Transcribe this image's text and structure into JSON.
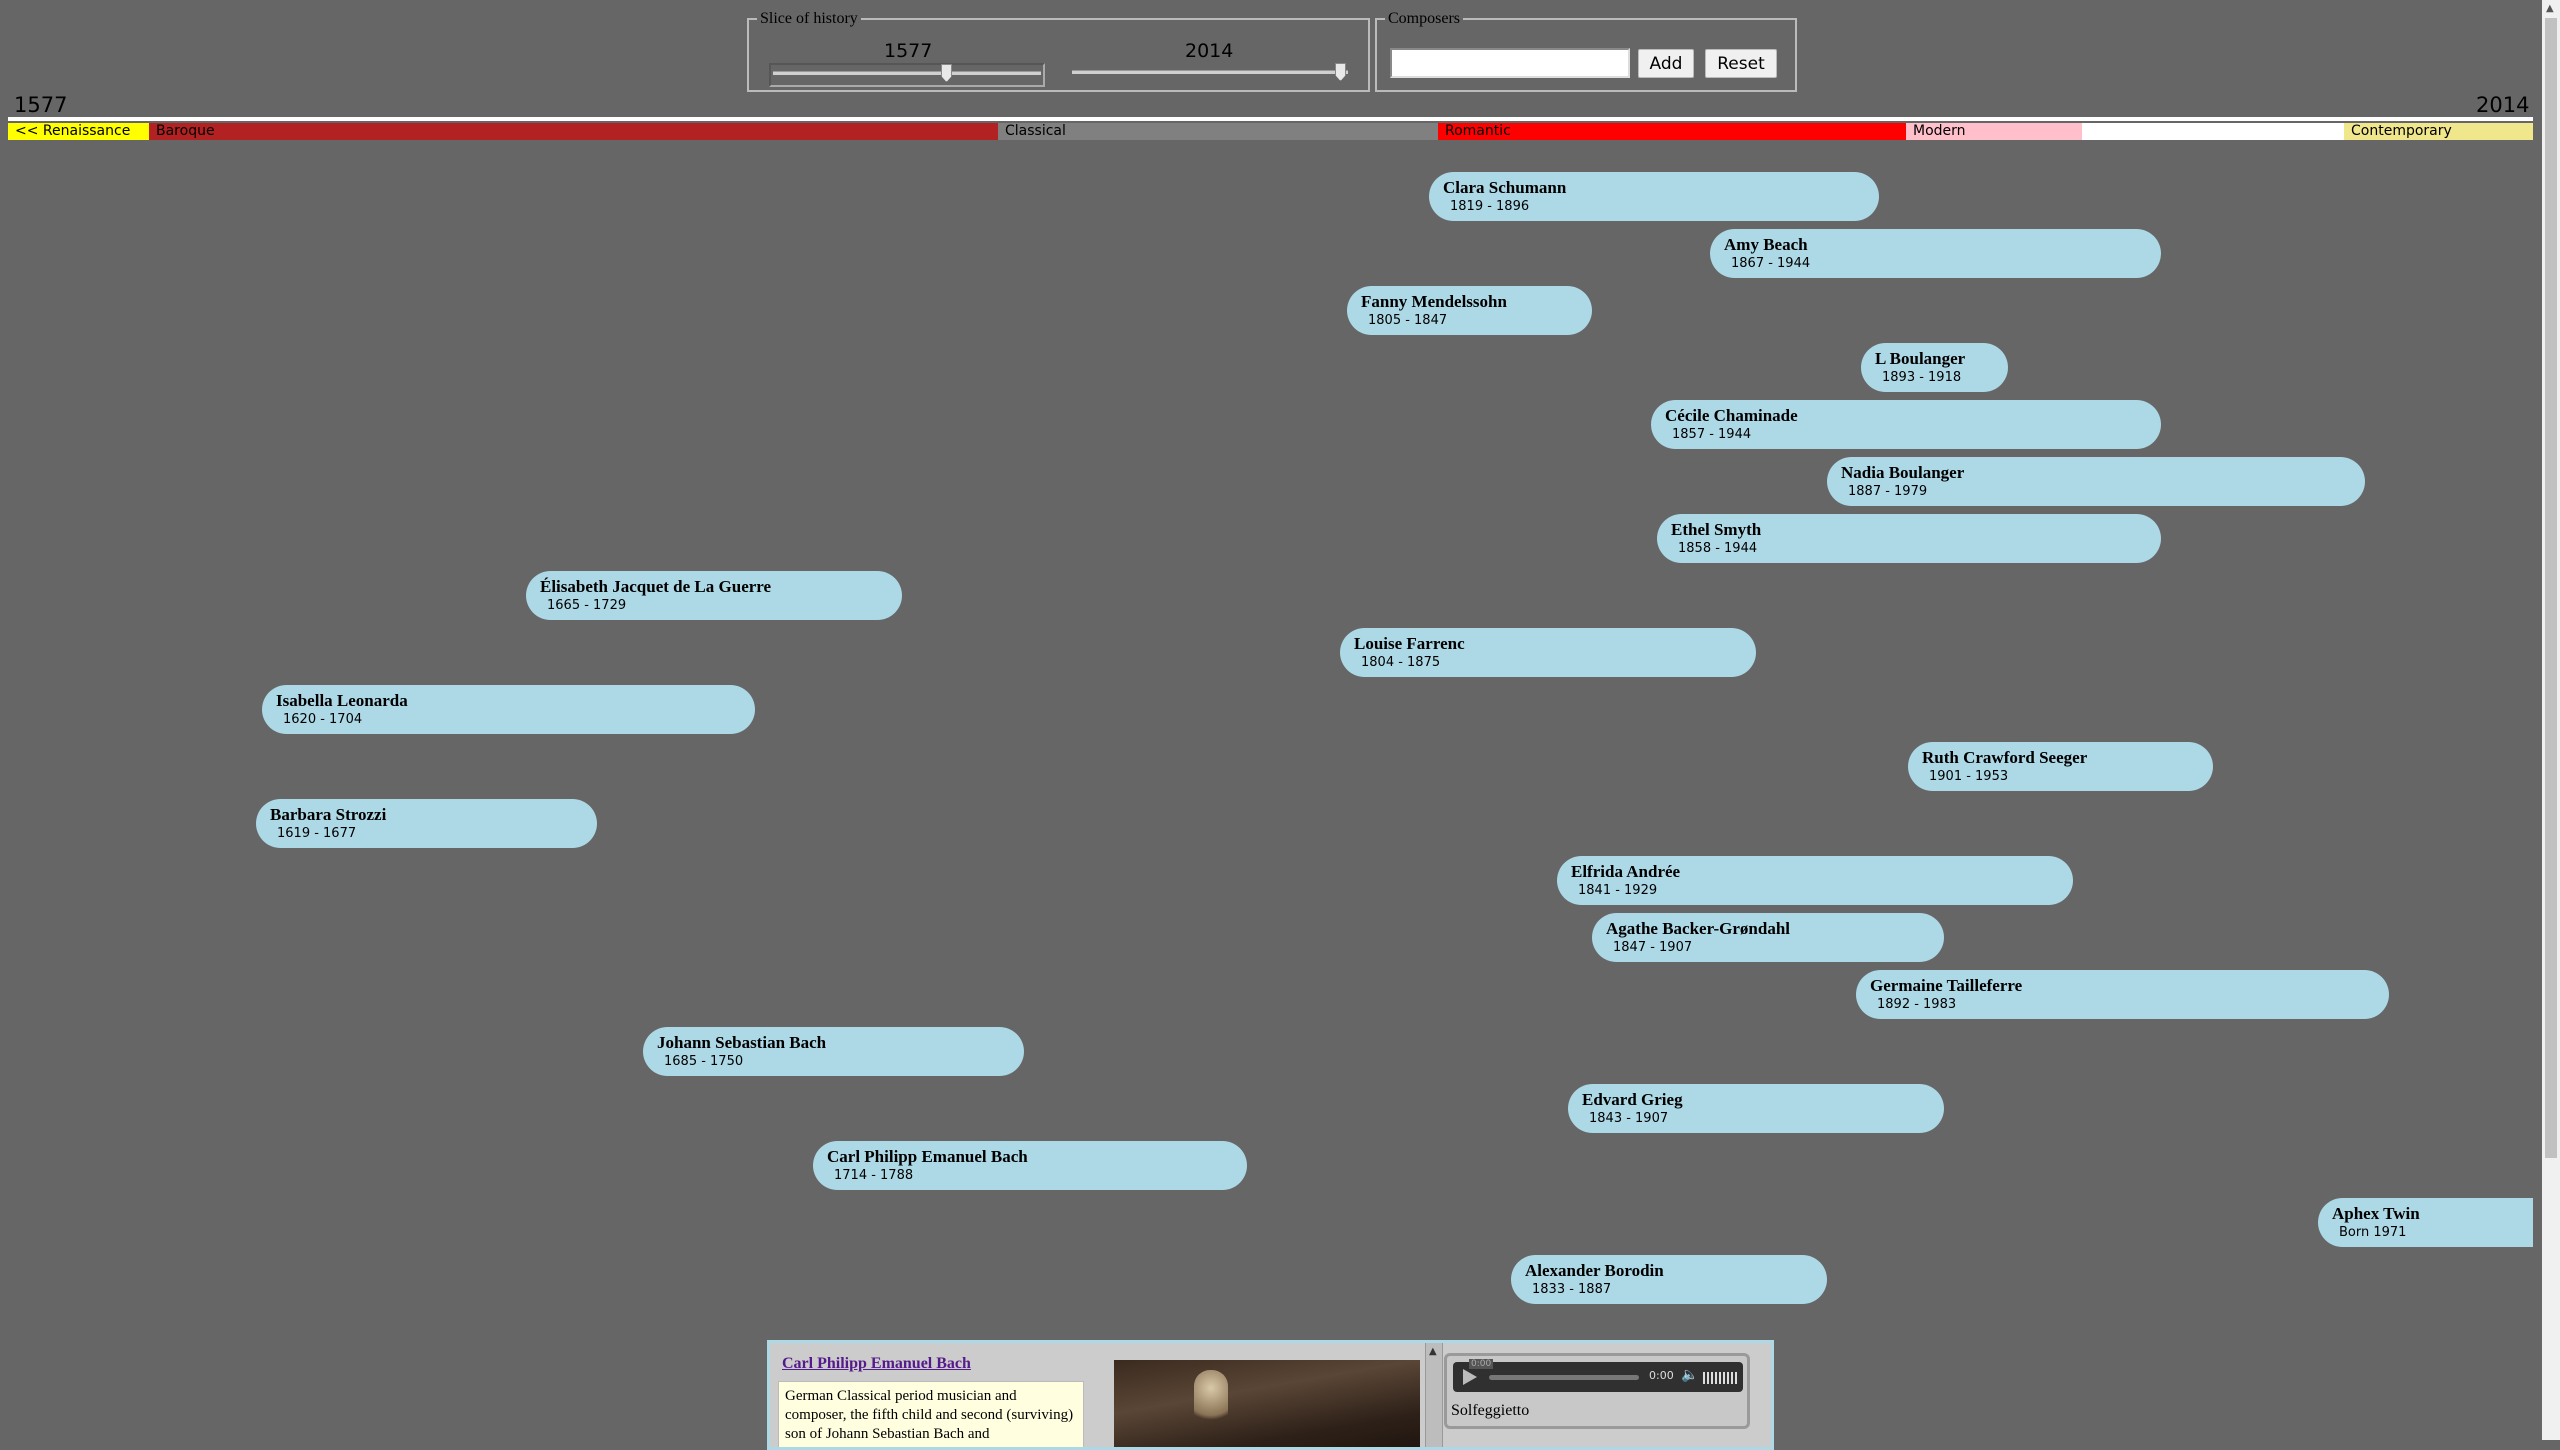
{
  "controls": {
    "slice_legend": "Slice of history",
    "start_year": "1577",
    "end_year": "2014",
    "composers_legend": "Composers",
    "composer_input_value": "",
    "composer_input_placeholder": "",
    "add_label": "Add",
    "reset_label": "Reset"
  },
  "axis": {
    "left_label": "1577",
    "right_label": "2014"
  },
  "eras": [
    {
      "label": "<< Renaissance",
      "color": "#ffff00"
    },
    {
      "label": "Baroque",
      "color": "#b22222"
    },
    {
      "label": "Classical",
      "color": "#808080"
    },
    {
      "label": "Romantic",
      "color": "#ff0000"
    },
    {
      "label": "Modern",
      "color": "#ffc0cb"
    },
    {
      "label": "Contemporary",
      "color": "#f0e68c"
    }
  ],
  "composers": [
    {
      "name": "Clara Schumann",
      "dates": "1819 - 1896"
    },
    {
      "name": "Amy Beach",
      "dates": "1867 - 1944"
    },
    {
      "name": "Fanny Mendelssohn",
      "dates": "1805 - 1847"
    },
    {
      "name": "L Boulanger",
      "dates": "1893 - 1918"
    },
    {
      "name": "Cécile Chaminade",
      "dates": "1857 - 1944"
    },
    {
      "name": "Nadia Boulanger",
      "dates": "1887 - 1979"
    },
    {
      "name": "Ethel Smyth",
      "dates": "1858 - 1944"
    },
    {
      "name": "Élisabeth Jacquet de La Guerre",
      "dates": "1665 - 1729"
    },
    {
      "name": "Louise Farrenc",
      "dates": "1804 - 1875"
    },
    {
      "name": "Isabella Leonarda",
      "dates": "1620 - 1704"
    },
    {
      "name": "Ruth Crawford Seeger",
      "dates": "1901 - 1953"
    },
    {
      "name": "Barbara Strozzi",
      "dates": "1619 - 1677"
    },
    {
      "name": "Elfrida Andrée",
      "dates": "1841 - 1929"
    },
    {
      "name": "Agathe Backer-Grøndahl",
      "dates": "1847 - 1907"
    },
    {
      "name": "Germaine Tailleferre",
      "dates": "1892 - 1983"
    },
    {
      "name": "Johann Sebastian Bach",
      "dates": "1685 - 1750"
    },
    {
      "name": "Edvard Grieg",
      "dates": "1843 - 1907"
    },
    {
      "name": "Carl Philipp Emanuel Bach",
      "dates": "1714 - 1788"
    },
    {
      "name": "Aphex Twin",
      "dates": "Born 1971"
    },
    {
      "name": "Alexander Borodin",
      "dates": "1833 - 1887"
    }
  ],
  "info": {
    "title": "Carl Philipp Emanuel Bach",
    "description": "German Classical period musician and composer, the fifth child and second (surviving) son of Johann Sebastian Bach and",
    "player_time_top": "0:00",
    "player_time": "0:00",
    "track_name": "Solfeggietto"
  }
}
